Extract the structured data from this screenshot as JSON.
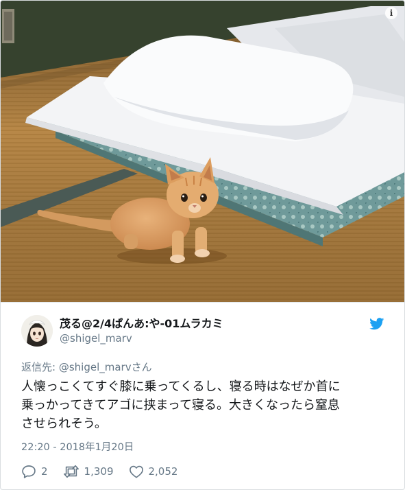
{
  "tweet": {
    "display_name": "茂る@2/4ぱんあ:や-01ムラカミ",
    "handle": "@shigel_marv",
    "reply_prefix": "返信先: ",
    "reply_to": "@shigel_marv",
    "reply_suffix": "さん",
    "text_lines": [
      "人懐っこくてすぐ膝に乗ってくるし、寝る時はなぜか首に",
      "乗っかってきてアゴに挟まって寝る。大きくなったら窒息",
      "させられそう。"
    ],
    "timestamp": "22:20 - 2018年1月20日",
    "replies": "2",
    "retweets": "1,309",
    "likes": "2,052"
  },
  "icons": {
    "info": "info-icon",
    "brand": "twitter-bird-icon",
    "reply": "reply-icon",
    "retweet": "retweet-icon",
    "like": "heart-icon"
  },
  "colors": {
    "brand_blue": "#1da1f2",
    "secondary_text": "#657786",
    "primary_text": "#14171a"
  }
}
